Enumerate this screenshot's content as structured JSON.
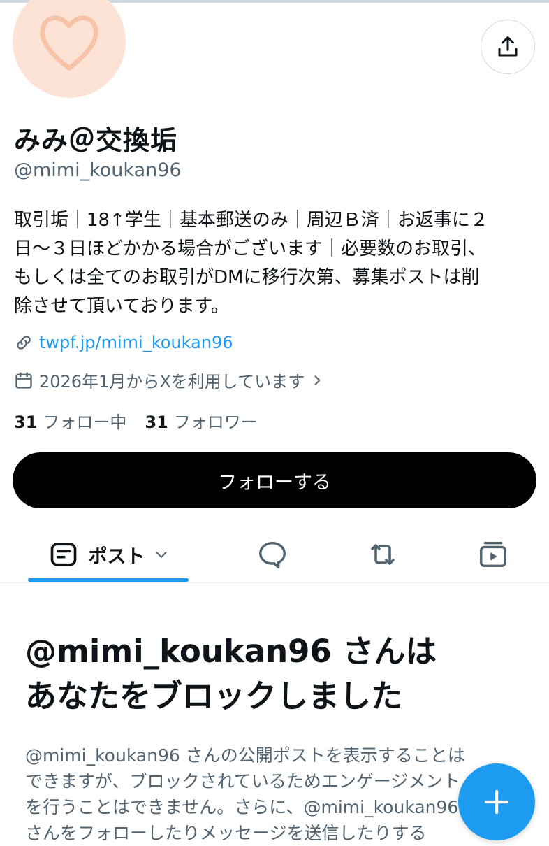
{
  "profile": {
    "display_name": "みみ＠交換垢",
    "handle": "@mimi_koukan96",
    "bio_lines": [
      "取引垢｜18↑学生｜基本郵送のみ｜周辺Ｂ済｜お返事に２",
      "日〜３日ほどかかる場合がございます｜必要数のお取引、",
      "もしくは全てのお取引がDMに移行次第、募集ポストは削",
      "除させて頂いております。"
    ],
    "link": "twpf.jp/mimi_koukan96",
    "joined": "2026年1月からXを利用しています",
    "following_count": "31",
    "following_label": "フォロー中",
    "followers_count": "31",
    "followers_label": "フォロワー",
    "follow_button": "フォローする"
  },
  "tabs": {
    "posts_label": "ポスト"
  },
  "blocked": {
    "title_lines": [
      "@mimi_koukan96 さんは",
      "あなたをブロックしました"
    ],
    "desc_lines": [
      "@mimi_koukan96 さんの公開ポストを表示することは",
      "できますが、ブロックされているためエンゲージメント",
      "を行うことはできません。さらに、@mimi_koukan96",
      "さんをフォローしたりメッセージを送信したりする"
    ]
  },
  "colors": {
    "accent": "#1d9bf0",
    "secondary_text": "#536471",
    "avatar_bg": "#fde3d6"
  },
  "icons": {
    "share": "share-icon",
    "link": "link-icon",
    "calendar": "calendar-icon",
    "chevron": "chevron-right-icon",
    "posts_tab": "posts-tab-icon",
    "dropdown": "chevron-down-icon",
    "replies_tab": "reply-icon",
    "reposts_tab": "repost-icon",
    "media_tab": "media-icon",
    "compose": "plus-icon"
  }
}
